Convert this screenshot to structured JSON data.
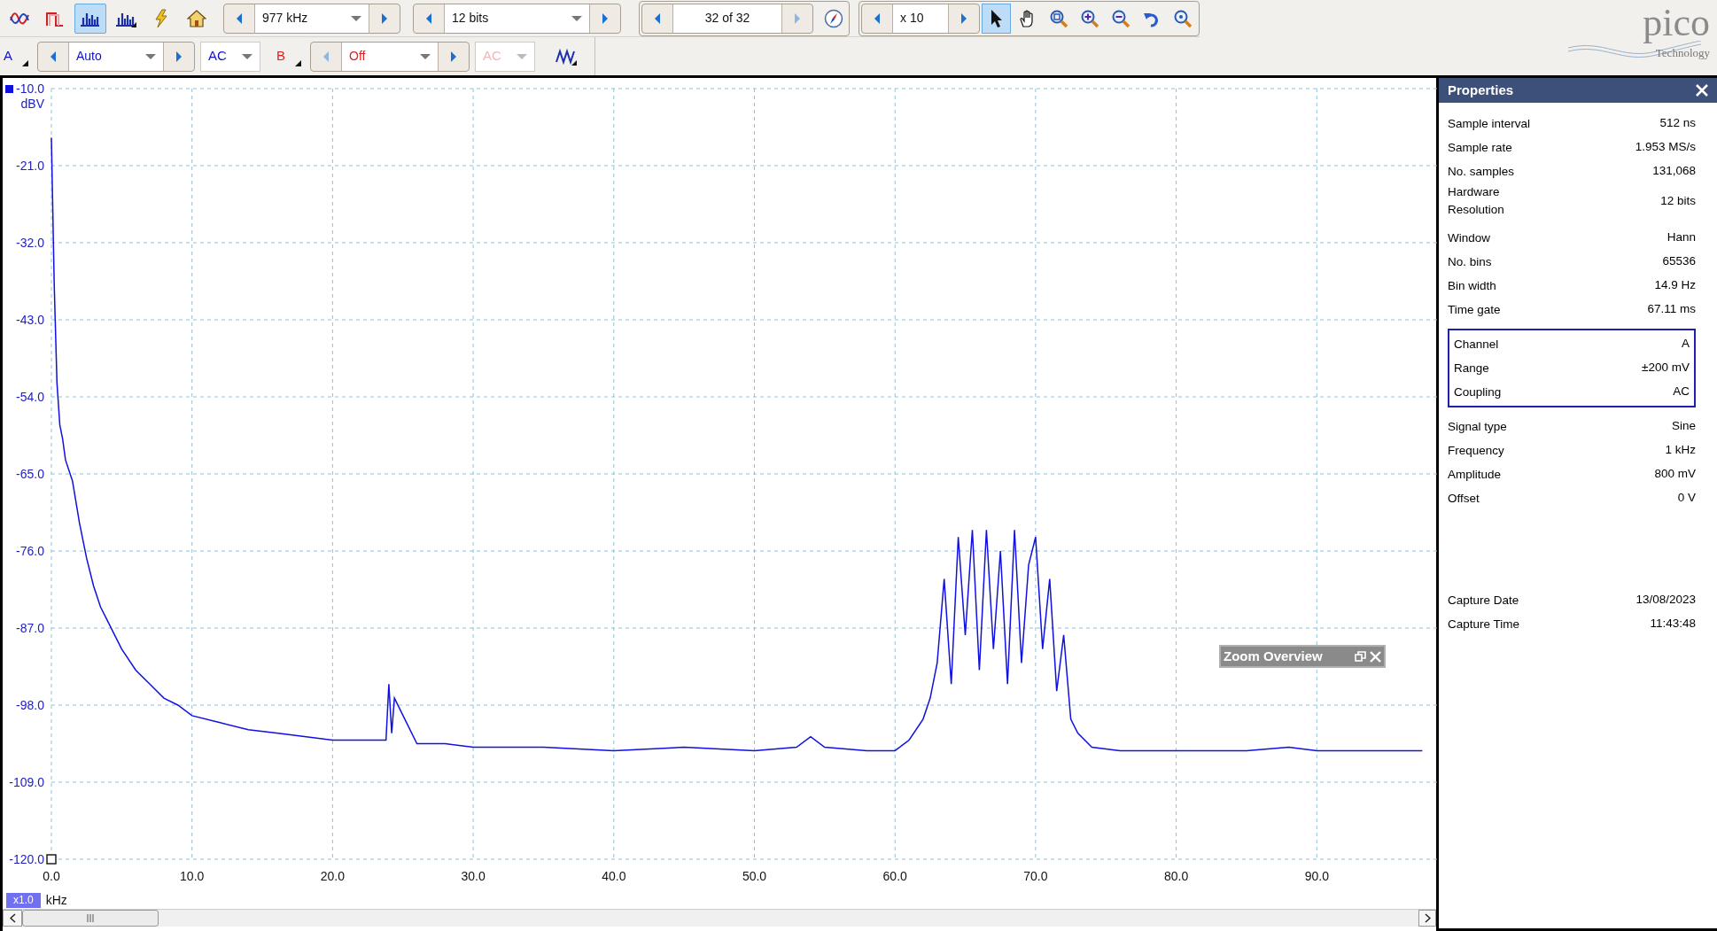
{
  "toolbar": {
    "mode_buttons": [
      {
        "kind": "scope",
        "selected": false
      },
      {
        "kind": "persistence",
        "selected": false
      },
      {
        "kind": "spectrum",
        "selected": true
      },
      {
        "kind": "spectrum_persistence",
        "selected": false
      },
      {
        "kind": "auto_setup",
        "selected": false
      },
      {
        "kind": "home",
        "selected": false
      }
    ],
    "timebase": {
      "value": "977 kHz"
    },
    "resolution": {
      "value": "12 bits"
    },
    "buffer": {
      "value": "32 of 32"
    },
    "zoom_factor": {
      "value": "x 10"
    },
    "tools": [
      {
        "kind": "pointer",
        "selected": true
      },
      {
        "kind": "hand",
        "selected": false
      },
      {
        "kind": "zoom_fit",
        "selected": false
      },
      {
        "kind": "zoom_in",
        "selected": false
      },
      {
        "kind": "zoom_out",
        "selected": false
      },
      {
        "kind": "undo",
        "selected": false
      },
      {
        "kind": "zoom_100",
        "selected": false
      }
    ]
  },
  "channels": [
    {
      "name": "A",
      "color": "#1010c8",
      "range": "Auto",
      "coupling": "AC",
      "enabled": true
    },
    {
      "name": "B",
      "color": "#e02020",
      "range": "Off",
      "coupling": "AC",
      "enabled": false
    }
  ],
  "logo": {
    "name": "pico",
    "tagline": "Technology"
  },
  "plot": {
    "x_zoom": "x1.0",
    "chart_data": {
      "type": "line",
      "xlabel": "kHz",
      "ylabel": "dBV",
      "grid": true,
      "xlim": [
        0,
        98.8
      ],
      "ylim": [
        -120,
        -10
      ],
      "xticks": [
        {
          "value": 0,
          "label": "0.0"
        },
        {
          "value": 10,
          "label": "10.0"
        },
        {
          "value": 20,
          "label": "20.0"
        },
        {
          "value": 30,
          "label": "30.0"
        },
        {
          "value": 40,
          "label": "40.0"
        },
        {
          "value": 50,
          "label": "50.0"
        },
        {
          "value": 60,
          "label": "60.0"
        },
        {
          "value": 70,
          "label": "70.0"
        },
        {
          "value": 80,
          "label": "80.0"
        },
        {
          "value": 90,
          "label": "90.0"
        }
      ],
      "yticks": [
        {
          "value": -10,
          "label": "-10.0"
        },
        {
          "value": -21,
          "label": "-21.0"
        },
        {
          "value": -32,
          "label": "-32.0"
        },
        {
          "value": -43,
          "label": "-43.0"
        },
        {
          "value": -54,
          "label": "-54.0"
        },
        {
          "value": -65,
          "label": "-65.0"
        },
        {
          "value": -76,
          "label": "-76.0"
        },
        {
          "value": -87,
          "label": "-87.0"
        },
        {
          "value": -98,
          "label": "-98.0"
        },
        {
          "value": -109,
          "label": "-109.0"
        },
        {
          "value": -120,
          "label": "-120.0"
        }
      ],
      "x": [
        0,
        0.2,
        0.4,
        0.6,
        0.8,
        1,
        1.5,
        2,
        2.5,
        3,
        3.5,
        4,
        5,
        6,
        7,
        8,
        9,
        10,
        12,
        14,
        16,
        18,
        20,
        22,
        23.8,
        24,
        24.2,
        24.4,
        26,
        28,
        30,
        35,
        40,
        45,
        50,
        53,
        54,
        55,
        58,
        60,
        61,
        62,
        62.5,
        63,
        63.5,
        64,
        64.5,
        65,
        65.5,
        66,
        66.5,
        67,
        67.5,
        68,
        68.5,
        69,
        69.5,
        70,
        70.5,
        71,
        71.5,
        72,
        72.5,
        73,
        74,
        76,
        80,
        85,
        88,
        90,
        95,
        97.5
      ],
      "series": [
        {
          "color": "#1010e0",
          "values": [
            -17,
            -38,
            -52,
            -58,
            -60,
            -63,
            -66,
            -72,
            -77,
            -81,
            -84,
            -86,
            -90,
            -93,
            -95,
            -97,
            -98,
            -99.5,
            -100.5,
            -101.5,
            -102,
            -102.5,
            -103,
            -103,
            -103,
            -95,
            -102,
            -97,
            -103.5,
            -103.5,
            -104,
            -104,
            -104.5,
            -104,
            -104.5,
            -104,
            -102.5,
            -104,
            -104.5,
            -104.5,
            -103,
            -100,
            -97,
            -92,
            -80,
            -95,
            -74,
            -88,
            -73,
            -93,
            -73,
            -90,
            -76,
            -95,
            -73,
            -92,
            -78,
            -74,
            -90,
            -80,
            -96,
            -88,
            -100,
            -102,
            -104,
            -104.5,
            -104.5,
            -104.5,
            -104,
            -104.5,
            -104.5,
            -104.5
          ]
        }
      ]
    }
  },
  "zoom_overview": {
    "title": "Zoom Overview"
  },
  "properties": {
    "title": "Properties",
    "sections": [
      {
        "boxed": false,
        "rows": [
          {
            "label": "Sample interval",
            "value": "512 ns"
          },
          {
            "label": "Sample rate",
            "value": "1.953 MS/s"
          },
          {
            "label": "No. samples",
            "value": "131,068"
          },
          {
            "label": "Hardware Resolution",
            "value": "12 bits"
          }
        ]
      },
      {
        "boxed": false,
        "rows": [
          {
            "label": "Window",
            "value": "Hann"
          },
          {
            "label": "No. bins",
            "value": "65536"
          },
          {
            "label": "Bin width",
            "value": "14.9 Hz"
          },
          {
            "label": "Time gate",
            "value": "67.11 ms"
          }
        ]
      },
      {
        "boxed": true,
        "rows": [
          {
            "label": "Channel",
            "value": "A"
          },
          {
            "label": "Range",
            "value": "±200 mV"
          },
          {
            "label": "Coupling",
            "value": "AC"
          }
        ]
      },
      {
        "boxed": false,
        "rows": [
          {
            "label": "Signal type",
            "value": "Sine"
          },
          {
            "label": "Frequency",
            "value": "1 kHz"
          },
          {
            "label": "Amplitude",
            "value": "800 mV"
          },
          {
            "label": "Offset",
            "value": "0 V"
          }
        ]
      },
      {
        "boxed": false,
        "rows": [
          {
            "label": "Capture Date",
            "value": "13/08/2023"
          },
          {
            "label": "Capture Time",
            "value": "11:43:48"
          }
        ]
      }
    ]
  }
}
